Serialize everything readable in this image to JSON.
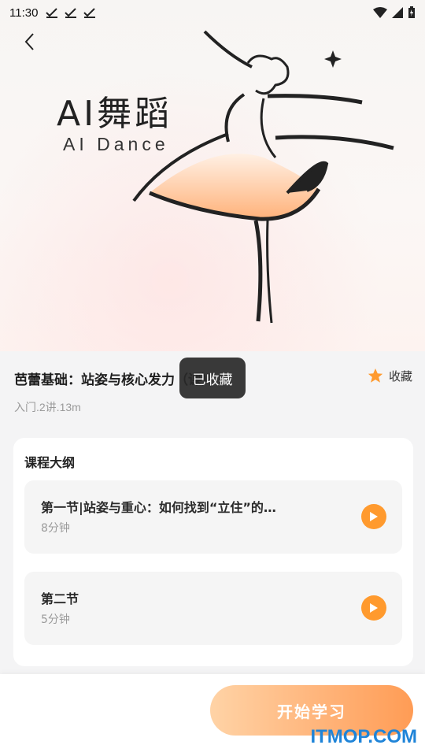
{
  "status_bar": {
    "time": "11:30"
  },
  "hero": {
    "title_cn": "AI舞蹈",
    "title_en": "AI Dance"
  },
  "course": {
    "title": "芭蕾基础：站姿与核心发力（课）",
    "meta": "入门.2讲.13m",
    "favorite_label": "收藏"
  },
  "toast": {
    "text": "已收藏"
  },
  "outline": {
    "heading": "课程大纲",
    "lessons": [
      {
        "title": "第一节|站姿与重心：如何找到“立住”的…",
        "duration": "8分钟"
      },
      {
        "title": "第二节",
        "duration": "5分钟"
      }
    ]
  },
  "bottom": {
    "start_label": "开始学习"
  },
  "watermark": {
    "text": "ITMOP.COM"
  },
  "colors": {
    "accent": "#ff9a2e",
    "gradient_start": "#ffd3a6",
    "gradient_end": "#ff9c55"
  }
}
